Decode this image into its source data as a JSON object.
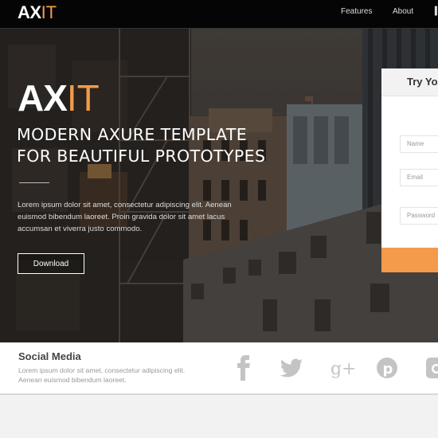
{
  "nav": {
    "logo_ax": "AX",
    "logo_it": "IT",
    "links": [
      "Features",
      "About",
      ""
    ]
  },
  "hero": {
    "logo_ax": "AX",
    "logo_it": "IT",
    "headline_line1": "MODERN AXURE TEMPLATE",
    "headline_line2": "FOR BEAUTIFUL PROTOTYPES",
    "body": "Lorem ipsum dolor sit amet, consectetur adipiscing elit. Aenean euismod bibendum laoreet. Proin gravida dolor sit amet lacus accumsan et viverra justo commodo.",
    "download_label": "Download"
  },
  "signup": {
    "title": "Try You",
    "name_placeholder": "Name",
    "email_placeholder": "Email",
    "password_placeholder": "Password"
  },
  "social": {
    "title": "Social Media",
    "text": "Lorem ipsum dolor sit amet, consectetur adipiscing elit. Aenean euismod bibendum laoreet.",
    "icons": [
      "facebook-icon",
      "twitter-icon",
      "google-plus-icon",
      "pinterest-icon",
      "instagram-icon"
    ]
  },
  "colors": {
    "accent": "#f39b4b",
    "nav_bg": "#050505",
    "social_icon": "#bdbdbd"
  }
}
